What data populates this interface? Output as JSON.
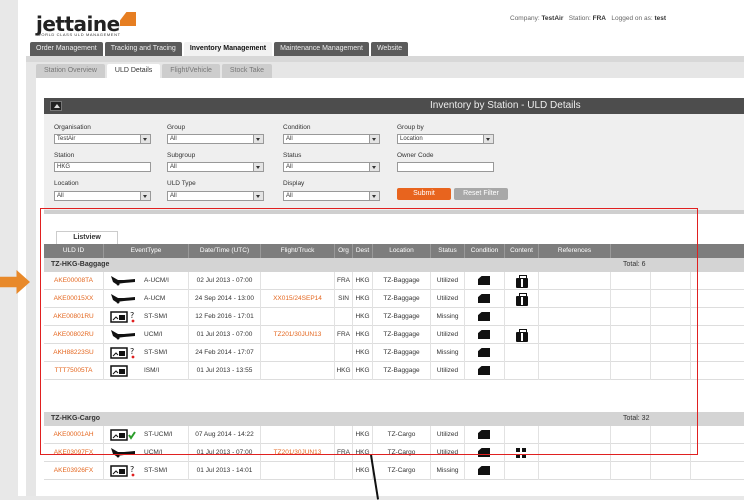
{
  "brand": {
    "name": "jettaine",
    "tagline": "WORLD CLASS ULD MANAGEMENT"
  },
  "topinfo": {
    "company_label": "Company:",
    "company": "TestAir",
    "station_label": "Station:",
    "station": "FRA",
    "logged_label": "Logged on as:",
    "user": "test"
  },
  "main_tabs": [
    "Order Management",
    "Tracking and Tracing",
    "Inventory Management",
    "Maintenance Management",
    "Website"
  ],
  "sub_tabs": [
    "Station Overview",
    "ULD Details",
    "Flight/Vehicle",
    "Stock Take"
  ],
  "panel_title": "Inventory by Station - ULD Details",
  "filters": {
    "organisation": {
      "label": "Organisation",
      "value": "TestAir"
    },
    "group": {
      "label": "Group",
      "value": "All"
    },
    "condition": {
      "label": "Condition",
      "value": "All"
    },
    "group_by": {
      "label": "Group by",
      "value": "Location"
    },
    "station": {
      "label": "Station",
      "value": "HKG"
    },
    "subgroup": {
      "label": "Subgroup",
      "value": "All"
    },
    "status": {
      "label": "Status",
      "value": "All"
    },
    "owner_code": {
      "label": "Owner Code",
      "value": ""
    },
    "location": {
      "label": "Location",
      "value": "All"
    },
    "uld_type": {
      "label": "ULD Type",
      "value": "All"
    },
    "display": {
      "label": "Display",
      "value": "All"
    }
  },
  "buttons": {
    "submit": "Submit",
    "reset": "Reset Filter"
  },
  "list_tab": "Listview",
  "columns": [
    "ULD ID",
    "EventType",
    "Date/Time (UTC)",
    "Flight/Truck",
    "Org",
    "Dest",
    "Location",
    "Status",
    "Condition",
    "Content",
    "References"
  ],
  "groups": [
    {
      "name": "TZ-HKG-Baggage",
      "total": "Total: 6"
    },
    {
      "name": "TZ-HKG-Cargo",
      "total": "Total: 32"
    }
  ],
  "rows_baggage": [
    {
      "uld": "AKE00008TA",
      "event": "A-UCM/I",
      "date": "02 Jul 2013 - 07:00",
      "flight": "",
      "org": "FRA",
      "dest": "HKG",
      "location": "TZ-Baggage",
      "status": "Utilized",
      "content": "bag"
    },
    {
      "uld": "AKE00015XX",
      "event": "A-UCM",
      "date": "24 Sep 2014 - 13:00",
      "flight": "XX015/24SEP14",
      "org": "SIN",
      "dest": "HKG",
      "location": "TZ-Baggage",
      "status": "Utilized",
      "content": "bag"
    },
    {
      "uld": "AKE00801RU",
      "event": "ST-SM/I",
      "date": "12 Feb 2016 - 17:01",
      "flight": "",
      "org": "",
      "dest": "HKG",
      "location": "TZ-Baggage",
      "status": "Missing",
      "content": ""
    },
    {
      "uld": "AKE00802RU",
      "event": "UCM/I",
      "date": "01 Jul 2013 - 07:00",
      "flight": "TZ201/30JUN13",
      "org": "FRA",
      "dest": "HKG",
      "location": "TZ-Baggage",
      "status": "Utilized",
      "content": "bag"
    },
    {
      "uld": "AKH88223SU",
      "event": "ST-SM/I",
      "date": "24 Feb 2014 - 17:07",
      "flight": "",
      "org": "",
      "dest": "HKG",
      "location": "TZ-Baggage",
      "status": "Missing",
      "content": ""
    },
    {
      "uld": "TTT75005TA",
      "event": "ISM/I",
      "date": "01 Jul 2013 - 13:55",
      "flight": "",
      "org": "HKG",
      "dest": "HKG",
      "location": "TZ-Baggage",
      "status": "Utilized",
      "content": ""
    }
  ],
  "rows_cargo": [
    {
      "uld": "AKE00001AH",
      "event": "ST-UCM/I",
      "date": "07 Aug 2014 - 14:22",
      "flight": "",
      "org": "",
      "dest": "HKG",
      "location": "TZ-Cargo",
      "status": "Utilized",
      "content": ""
    },
    {
      "uld": "AKE03097FX",
      "event": "UCM/I",
      "date": "01 Jul 2013 - 07:00",
      "flight": "TZ201/30JUN13",
      "org": "FRA",
      "dest": "HKG",
      "location": "TZ-Cargo",
      "status": "Utilized",
      "content": "grid"
    },
    {
      "uld": "AKE03926FX",
      "event": "ST-SM/I",
      "date": "01 Jul 2013 - 14:01",
      "flight": "",
      "org": "",
      "dest": "HKG",
      "location": "TZ-Cargo",
      "status": "Missing",
      "content": ""
    }
  ],
  "colors": {
    "accent": "#e8641e",
    "header_bg": "#4d4d4d",
    "tab_bg": "#5b5b5b",
    "highlight": "#e02020"
  }
}
